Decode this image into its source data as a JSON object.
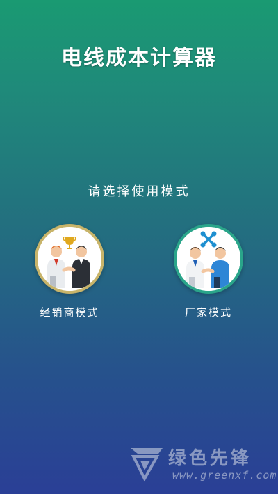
{
  "app": {
    "title": "电线成本计算器"
  },
  "mode_select": {
    "prompt": "请选择使用模式",
    "modes": [
      {
        "label": "经销商模式",
        "icon": "trophy-handshake-icon",
        "accent": "#c8b46a"
      },
      {
        "label": "厂家模式",
        "icon": "wrench-handshake-icon",
        "accent": "#2aa58a"
      }
    ]
  },
  "watermark": {
    "brand": "绿色先锋",
    "url": "www.greenxf.com"
  },
  "colors": {
    "gradient_top": "#1a9a72",
    "gradient_bottom": "#2a3f96",
    "text": "#ffffff"
  }
}
